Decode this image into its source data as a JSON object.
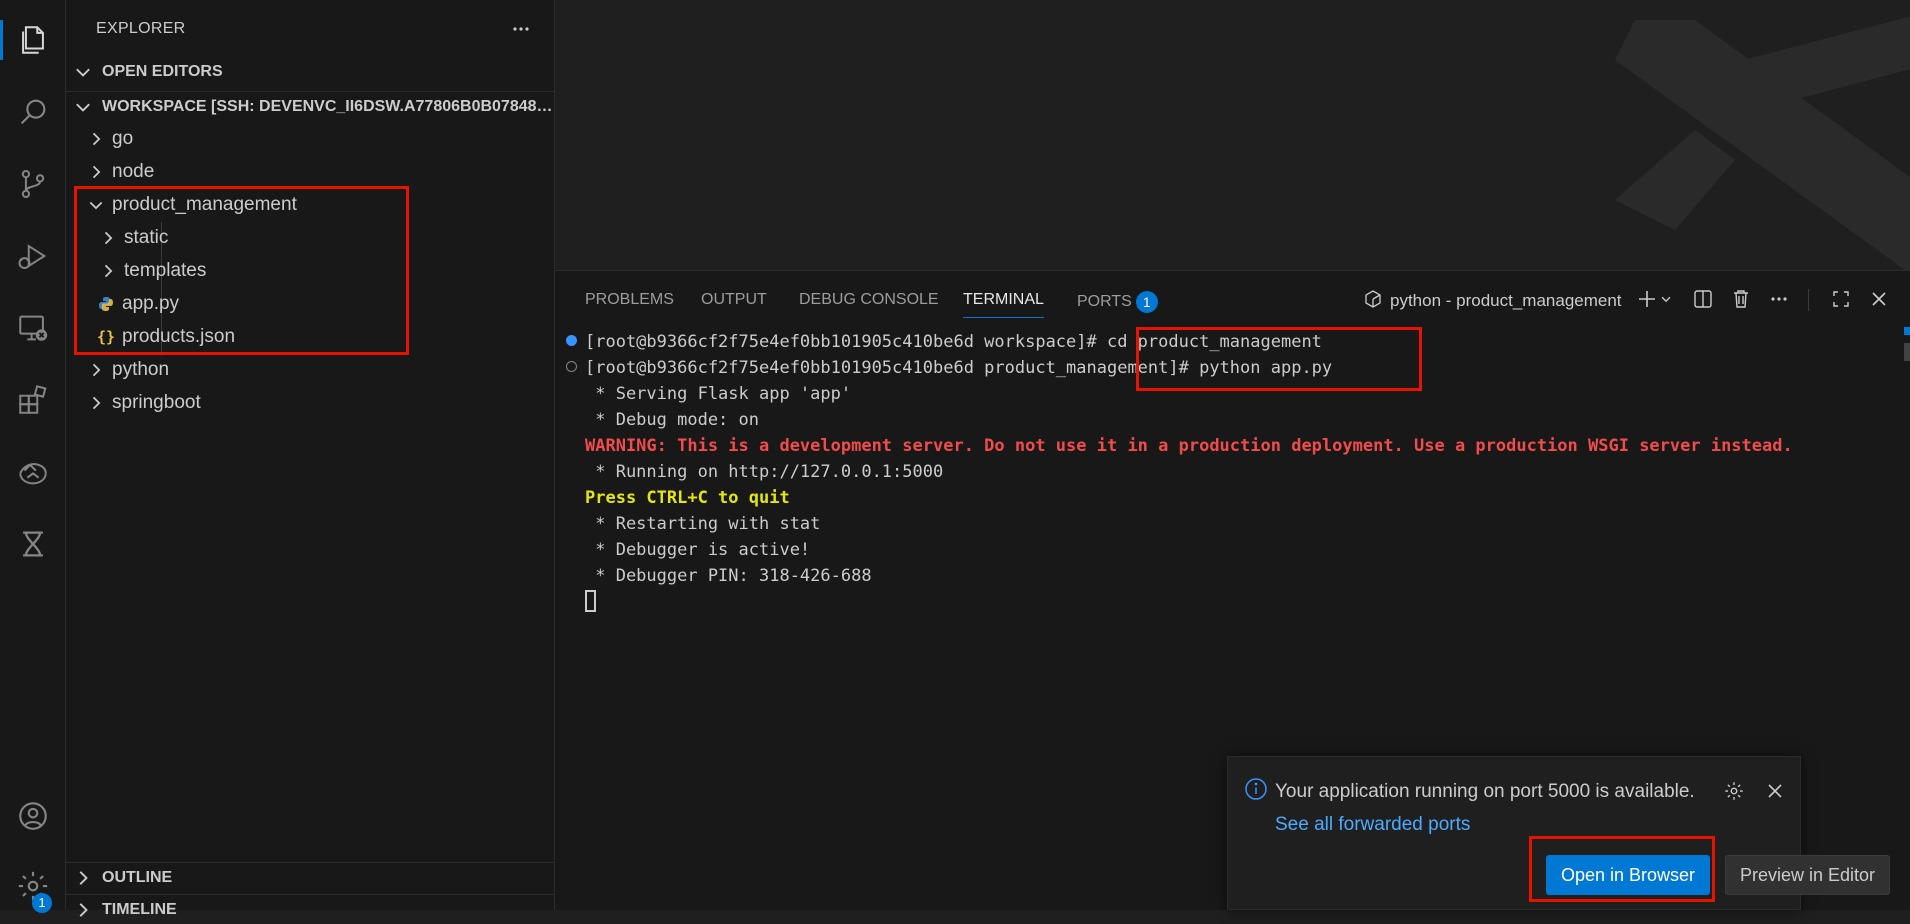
{
  "sidebar": {
    "title": "EXPLORER",
    "open_editors": "OPEN EDITORS",
    "workspace": "WORKSPACE [SSH: DEVENVC_II6DSW.A77806B0B078484...",
    "tree": {
      "go": "go",
      "node": "node",
      "product_management": "product_management",
      "static": "static",
      "templates": "templates",
      "app_py": "app.py",
      "products_json": "products.json",
      "python": "python",
      "springboot": "springboot"
    },
    "outline": "OUTLINE",
    "timeline": "TIMELINE"
  },
  "activity_bar": {
    "icons": [
      "files-icon",
      "search-icon",
      "source-control-icon",
      "run-debug-icon",
      "remote-explorer-icon",
      "extensions-icon",
      "docker-icon",
      "testing-icon",
      "account-icon",
      "settings-icon"
    ],
    "settings_badge": "1"
  },
  "panel": {
    "tabs": {
      "problems": "PROBLEMS",
      "output": "OUTPUT",
      "debug_console": "DEBUG CONSOLE",
      "terminal": "TERMINAL",
      "ports": "PORTS"
    },
    "ports_badge": "1",
    "terminal_name": "python - product_management",
    "lines": [
      "[root@b9366cf2f75e4ef0bb101905c410be6d workspace]# cd product_management",
      "[root@b9366cf2f75e4ef0bb101905c410be6d product_management]# python app.py",
      " * Serving Flask app 'app'",
      " * Debug mode: on",
      "WARNING: This is a development server. Do not use it in a production deployment. Use a production WSGI server instead.",
      " * Running on http://127.0.0.1:5000",
      "Press CTRL+C to quit",
      " * Restarting with stat",
      " * Debugger is active!",
      " * Debugger PIN: 318-426-688"
    ]
  },
  "notification": {
    "message": "Your application running on port 5000 is available.",
    "link": "See all forwarded ports",
    "primary_button": "Open in Browser",
    "secondary_button": "Preview in Editor"
  },
  "colors": {
    "accent": "#0078d4",
    "highlight_box": "#e51400",
    "warning_text": "#f14c4c",
    "yellow_text": "#e5e510"
  }
}
